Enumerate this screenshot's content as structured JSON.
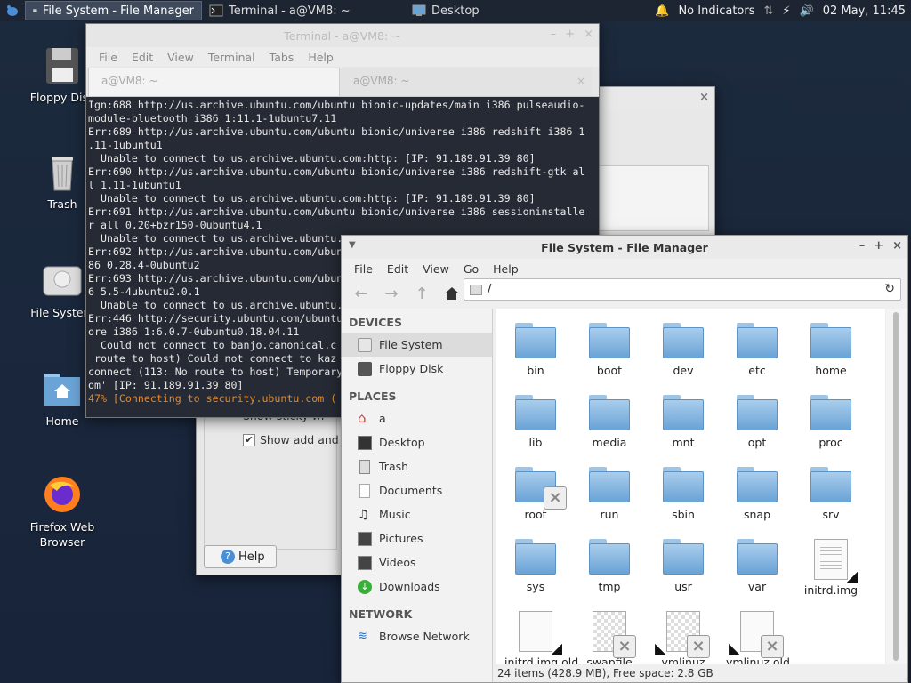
{
  "panel": {
    "tasks": [
      {
        "label": "File System - File Manager",
        "active": true
      },
      {
        "label": "Terminal - a@VM8: ~",
        "active": false
      },
      {
        "label": "Desktop",
        "active": false
      }
    ],
    "indicators_label": "No Indicators",
    "clock": "02 May, 11:45"
  },
  "desktop_icons": [
    {
      "label": "Floppy Disk"
    },
    {
      "label": "Trash"
    },
    {
      "label": "File System"
    },
    {
      "label": "Home"
    },
    {
      "label": "Firefox Web Browser"
    }
  ],
  "settings_window": {
    "checkbox_partial": "Show sticky wi",
    "checkbox_add_label": "Show add and re",
    "help_label": "Help"
  },
  "terminal": {
    "title": "Terminal - a@VM8: ~",
    "menu": [
      "File",
      "Edit",
      "View",
      "Terminal",
      "Tabs",
      "Help"
    ],
    "tabs": [
      "a@VM8: ~",
      "a@VM8: ~"
    ],
    "lines": [
      "Ign:688 http://us.archive.ubuntu.com/ubuntu bionic-updates/main i386 pulseaudio-",
      "module-bluetooth i386 1:11.1-1ubuntu7.11",
      "Err:689 http://us.archive.ubuntu.com/ubuntu bionic/universe i386 redshift i386 1",
      ".11-1ubuntu1",
      "  Unable to connect to us.archive.ubuntu.com:http: [IP: 91.189.91.39 80]",
      "Err:690 http://us.archive.ubuntu.com/ubuntu bionic/universe i386 redshift-gtk al",
      "l 1.11-1ubuntu1",
      "  Unable to connect to us.archive.ubuntu.com:http: [IP: 91.189.91.39 80]",
      "Err:691 http://us.archive.ubuntu.com/ubuntu bionic/universe i386 sessioninstalle",
      "r all 0.20+bzr150-0ubuntu4.1",
      "  Unable to connect to us.archive.ubuntu.",
      "Err:692 http://us.archive.ubuntu.com/ubun",
      "86 0.28.4-0ubuntu2",
      "Err:693 http://us.archive.ubuntu.com/ubun",
      "6 5.5-4ubuntu2.0.1",
      "  Unable to connect to us.archive.ubuntu.",
      "Err:446 http://security.ubuntu.com/ubuntu",
      "ore i386 1:6.0.7-0ubuntu0.18.04.11",
      "  Could not connect to banjo.canonical.c",
      " route to host) Could not connect to kaz",
      "connect (113: No route to host) Temporary",
      "om' [IP: 91.189.91.39 80]"
    ],
    "progress_line": "47% [Connecting to security.ubuntu.com (",
    "ip_fragment": "[IP: 91.189.91.39 80]"
  },
  "file_manager": {
    "title": "File System - File Manager",
    "menu": [
      "File",
      "Edit",
      "View",
      "Go",
      "Help"
    ],
    "path": "/",
    "sidebar": {
      "devices_header": "DEVICES",
      "devices": [
        "File System",
        "Floppy Disk"
      ],
      "places_header": "PLACES",
      "places": [
        "a",
        "Desktop",
        "Trash",
        "Documents",
        "Music",
        "Pictures",
        "Videos",
        "Downloads"
      ],
      "network_header": "NETWORK",
      "network": [
        "Browse Network"
      ]
    },
    "items": [
      {
        "name": "bin",
        "kind": "folder"
      },
      {
        "name": "boot",
        "kind": "folder"
      },
      {
        "name": "dev",
        "kind": "folder"
      },
      {
        "name": "etc",
        "kind": "folder"
      },
      {
        "name": "home",
        "kind": "folder"
      },
      {
        "name": "lib",
        "kind": "folder"
      },
      {
        "name": "media",
        "kind": "folder"
      },
      {
        "name": "mnt",
        "kind": "folder"
      },
      {
        "name": "opt",
        "kind": "folder"
      },
      {
        "name": "proc",
        "kind": "folder"
      },
      {
        "name": "root",
        "kind": "folder-locked"
      },
      {
        "name": "run",
        "kind": "folder"
      },
      {
        "name": "sbin",
        "kind": "folder"
      },
      {
        "name": "snap",
        "kind": "folder"
      },
      {
        "name": "srv",
        "kind": "folder"
      },
      {
        "name": "sys",
        "kind": "folder"
      },
      {
        "name": "tmp",
        "kind": "folder"
      },
      {
        "name": "usr",
        "kind": "folder"
      },
      {
        "name": "var",
        "kind": "folder"
      },
      {
        "name": "initrd.img",
        "kind": "link-doc"
      },
      {
        "name": "initrd.img.old",
        "kind": "link-blank"
      },
      {
        "name": "swapfile",
        "kind": "file-locked"
      },
      {
        "name": "vmlinuz",
        "kind": "link-locked"
      },
      {
        "name": "vmlinuz.old",
        "kind": "link-locked-blank"
      }
    ],
    "status": "24 items (428.9 MB), Free space: 2.8 GB"
  }
}
